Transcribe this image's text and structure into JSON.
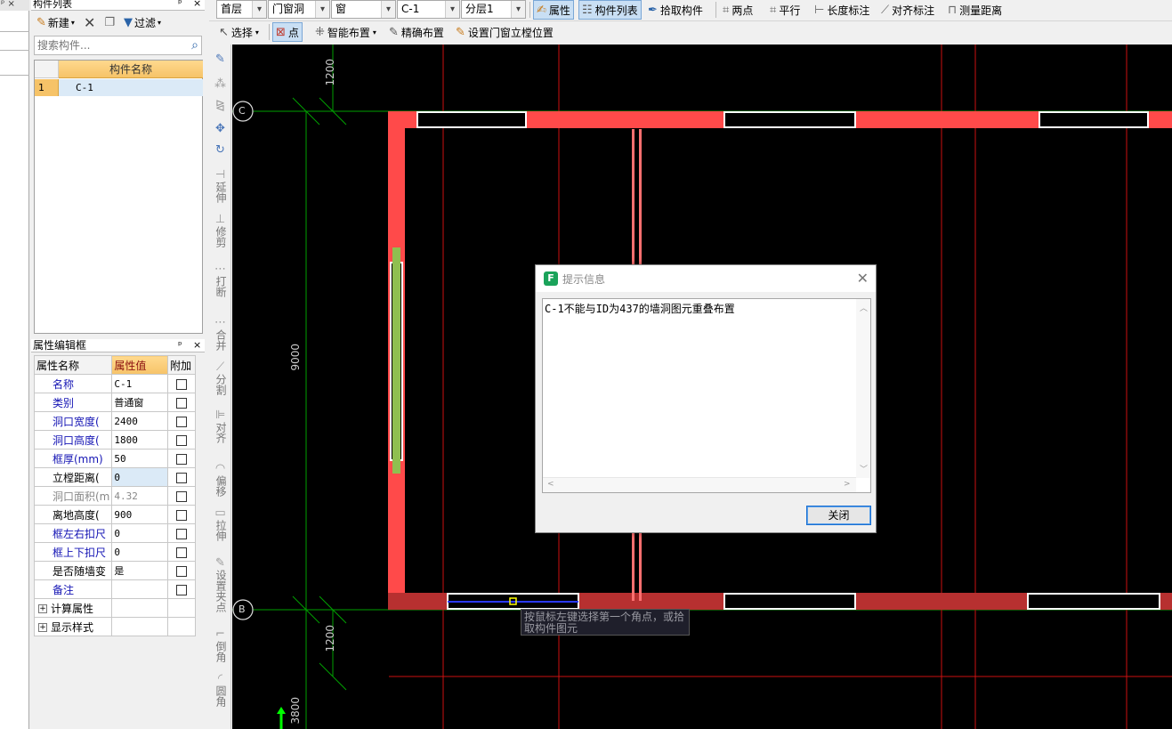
{
  "left_strip": {
    "pin": "ᵖ",
    "close": "×"
  },
  "component_panel": {
    "title": "构件列表",
    "pin": "ᵖ",
    "close": "×",
    "toolbar": {
      "new_label": "新建",
      "filter_label": "过滤"
    },
    "search": {
      "placeholder": "搜索构件..."
    },
    "table": {
      "header": "构件名称",
      "rows": [
        {
          "num": "1",
          "name": "C-1"
        }
      ]
    }
  },
  "property_panel": {
    "title": "属性编辑框",
    "pin": "ᵖ",
    "close": "×",
    "headers": {
      "name": "属性名称",
      "value": "属性值",
      "extra": "附加"
    },
    "rows": [
      {
        "name": "名称",
        "value": "C-1"
      },
      {
        "name": "类别",
        "value": "普通窗"
      },
      {
        "name": "洞口宽度(",
        "value": "2400"
      },
      {
        "name": "洞口高度(",
        "value": "1800"
      },
      {
        "name": "框厚(mm)",
        "value": "50"
      },
      {
        "name": "立樘距离(",
        "value": "0"
      },
      {
        "name": "洞口面积(m",
        "value": "4.32"
      },
      {
        "name": "离地高度(",
        "value": "900"
      },
      {
        "name": "框左右扣尺",
        "value": "0"
      },
      {
        "name": "框上下扣尺",
        "value": "0"
      },
      {
        "name": "是否随墙变",
        "value": "是"
      },
      {
        "name": "备注",
        "value": ""
      }
    ],
    "groups": [
      {
        "expander": "+",
        "label": "计算属性"
      },
      {
        "expander": "+",
        "label": "显示样式"
      }
    ]
  },
  "toolbar1": {
    "floor": "首层",
    "category": "门窗洞",
    "type": "窗",
    "component": "C-1",
    "layer": "分层1",
    "property_label": "属性",
    "component_list_label": "构件列表",
    "pick_label": "拾取构件",
    "two_point_label": "两点",
    "parallel_label": "平行",
    "length_dim_label": "长度标注",
    "align_dim_label": "对齐标注",
    "measure_label": "测量距离"
  },
  "toolbar2": {
    "select_label": "选择",
    "point_label": "点",
    "smart_layout_label": "智能布置",
    "precise_layout_label": "精确布置",
    "set_frame_label": "设置门窗立樘位置"
  },
  "vtools": [
    {
      "label": "延伸"
    },
    {
      "label": "修剪"
    },
    {
      "label": "打断"
    },
    {
      "label": "合并"
    },
    {
      "label": "分割"
    },
    {
      "label": "对齐"
    },
    {
      "label": "偏移"
    },
    {
      "label": "拉伸"
    },
    {
      "label": "设置夹点"
    },
    {
      "label": "倒角"
    },
    {
      "label": "圆角"
    }
  ],
  "canvas": {
    "axis_c": "C",
    "axis_b": "B",
    "dim_top": "1200",
    "dim_mid": "9000",
    "dim_bottom": "1200",
    "dim_lower": "3800"
  },
  "dialog": {
    "icon_letter": "F",
    "title": "提示信息",
    "message": "C-1不能与ID为437的墙洞图元重叠布置",
    "close_button": "关闭"
  },
  "tooltip": {
    "text": "按鼠标左键选择第一个角点，或拾取构件图元"
  },
  "colors": {
    "wall": "#ff4a4a",
    "wall_dark": "#b73030",
    "grid": "#00a000",
    "accent_green": "#8fbf50"
  }
}
